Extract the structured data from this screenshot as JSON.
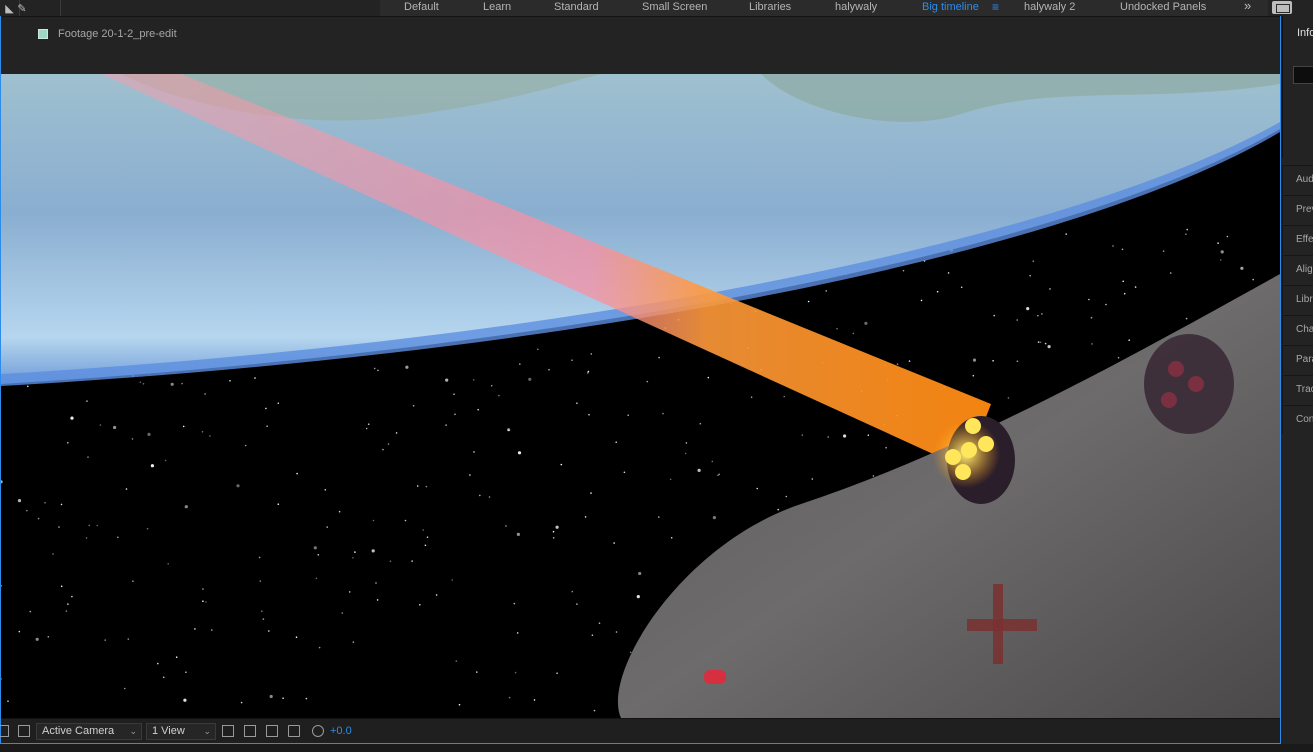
{
  "workspace_bar": {
    "workspaces": [
      {
        "label": "Default",
        "active": false
      },
      {
        "label": "Learn",
        "active": false
      },
      {
        "label": "Standard",
        "active": false
      },
      {
        "label": "Small Screen",
        "active": false
      },
      {
        "label": "Libraries",
        "active": false
      },
      {
        "label": "halywaly",
        "active": false
      },
      {
        "label": "Big timeline",
        "active": true
      },
      {
        "label": "halywaly 2",
        "active": false
      },
      {
        "label": "Undocked Panels",
        "active": false
      }
    ],
    "overflow_glyph": "»",
    "menu_glyph": "≡"
  },
  "viewer": {
    "title": "Footage 20-1-2_pre-edit",
    "swatch_color": "#9fd6c4",
    "footer": {
      "camera_label": "Active Camera",
      "view_label": "1 View",
      "exposure": "+0.0"
    }
  },
  "right_panel": {
    "info_label": "Info",
    "items": [
      "Audio",
      "Preview",
      "Effects & Presets",
      "Align",
      "Libraries",
      "Character",
      "Paragraph",
      "Tracker",
      "Content-Aware Fill"
    ]
  },
  "colors": {
    "accent": "#2d8ceb",
    "panel_bg": "#232323"
  }
}
